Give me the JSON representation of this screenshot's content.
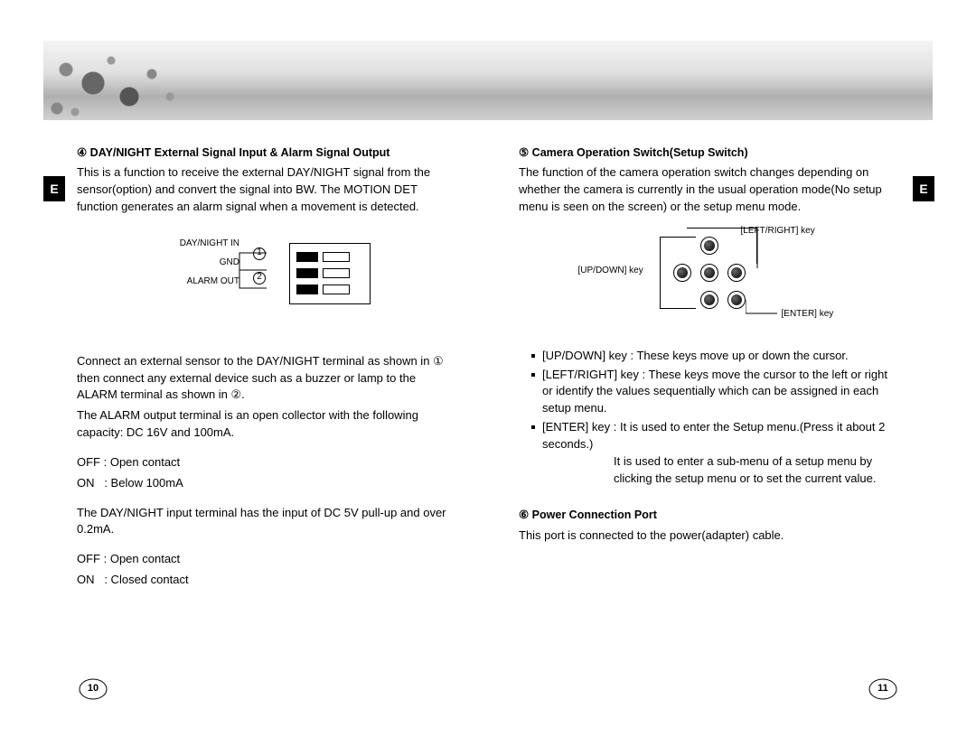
{
  "tabs": {
    "left": "E",
    "right": "E"
  },
  "left": {
    "heading": "④ DAY/NIGHT External Signal Input & Alarm Signal Output",
    "intro": "This is a function to receive the external DAY/NIGHT signal from the sensor(option) and convert the signal into BW. The MOTION DET function generates an alarm signal when a movement is detected.",
    "diagram": {
      "label_in": "DAY/NIGHT IN",
      "label_gnd": "GND",
      "label_alarm": "ALARM OUT",
      "num1": "1",
      "num2": "2"
    },
    "p1": "Connect an external sensor to the DAY/NIGHT terminal as shown in ① then connect any external device such as a buzzer or lamp to the ALARM terminal as shown in ②.",
    "p2": "The ALARM output terminal is an open collector with the following capacity: DC 16V and 100mA.",
    "p3a": "OFF : Open contact",
    "p3b": "ON   : Below 100mA",
    "p4": "The DAY/NIGHT input terminal has the input of DC 5V pull-up and over 0.2mA.",
    "p5a": "OFF : Open contact",
    "p5b": "ON   : Closed contact"
  },
  "right": {
    "heading": "⑤ Camera Operation Switch(Setup Switch)",
    "intro": "The function of the camera operation switch changes depending on whether the camera is currently in the usual operation mode(No setup menu is seen on the screen) or the setup menu mode.",
    "diagram": {
      "updown": "[UP/DOWN] key",
      "leftright": "[LEFT/RIGHT] key",
      "enter": "[ENTER] key"
    },
    "keys": [
      "[UP/DOWN] key : These keys move up or down the cursor.",
      "[LEFT/RIGHT] key : These keys move the cursor to the left or right or identify the values sequentially which can be assigned in each setup menu.",
      "[ENTER] key : It is used to enter the Setup menu.(Press it about 2 seconds.)"
    ],
    "enter_extra": "It is used to enter a sub-menu of a setup menu by clicking the setup menu or to set the current value.",
    "heading2": "⑥ Power Connection Port",
    "p6": "This port is connected to the power(adapter) cable."
  },
  "pages": {
    "left": "10",
    "right": "11"
  }
}
